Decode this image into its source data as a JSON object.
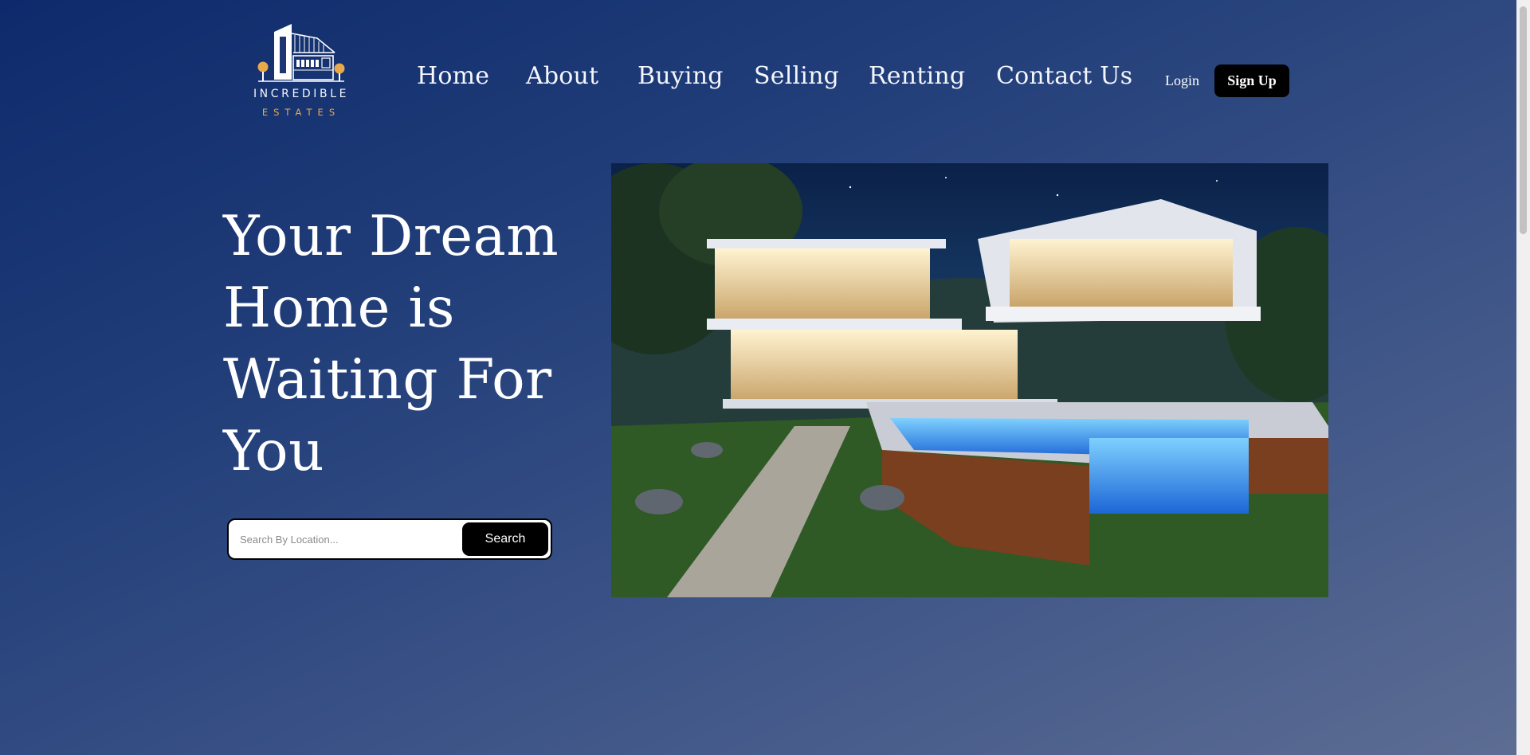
{
  "brand": {
    "name_line1": "INCREDIBLE",
    "name_line2": "ESTATES",
    "accent_color": "#e8a94a"
  },
  "nav": {
    "items": [
      {
        "label": "Home"
      },
      {
        "label": "About"
      },
      {
        "label": "Buying"
      },
      {
        "label": "Selling"
      },
      {
        "label": "Renting"
      },
      {
        "label": "Contact Us"
      }
    ],
    "login_label": "Login",
    "signup_label": "Sign Up"
  },
  "hero": {
    "title": "Your Dream Home is Waiting For You",
    "search": {
      "placeholder": "Search By Location...",
      "value": "",
      "button_label": "Search"
    },
    "image": "modern-house-night-pool"
  },
  "colors": {
    "background_start": "#0e2a6b",
    "background_end": "#5d6d93",
    "button_bg": "#000000",
    "text": "#ffffff"
  }
}
